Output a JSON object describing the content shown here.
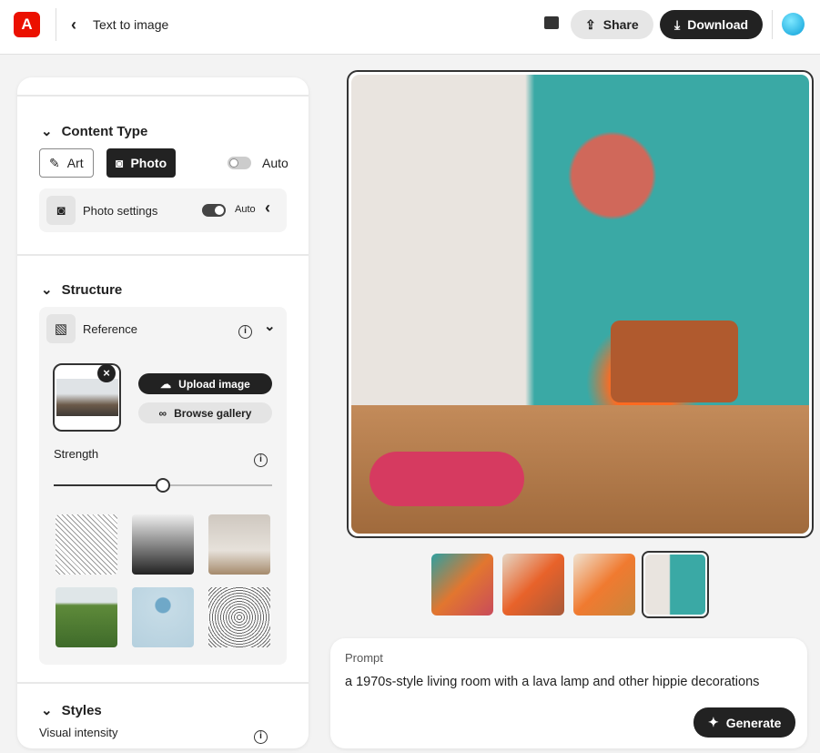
{
  "header": {
    "title": "Text to image",
    "share": "Share",
    "download": "Download"
  },
  "content_type": {
    "title": "Content Type",
    "art": "Art",
    "photo": "Photo",
    "auto": "Auto",
    "auto_on": false,
    "photo_settings": {
      "label": "Photo settings",
      "auto": "Auto",
      "auto_on": true
    }
  },
  "structure": {
    "title": "Structure",
    "reference": {
      "label": "Reference",
      "upload": "Upload image",
      "browse": "Browse gallery"
    },
    "strength": {
      "label": "Strength",
      "value": 0.5
    },
    "gallery": [
      "bird sketch",
      "misty valley",
      "living room",
      "green road",
      "blue sphere",
      "owl sketch"
    ]
  },
  "styles": {
    "title": "Styles",
    "visual_intensity": "Visual intensity"
  },
  "thumbnails": {
    "count": 4,
    "selected": 4
  },
  "prompt": {
    "label": "Prompt",
    "value": "a 1970s-style living room with a lava lamp and other hippie decorations",
    "generate": "Generate"
  },
  "colors": {
    "brand": "#eb1000",
    "dark": "#222222"
  }
}
